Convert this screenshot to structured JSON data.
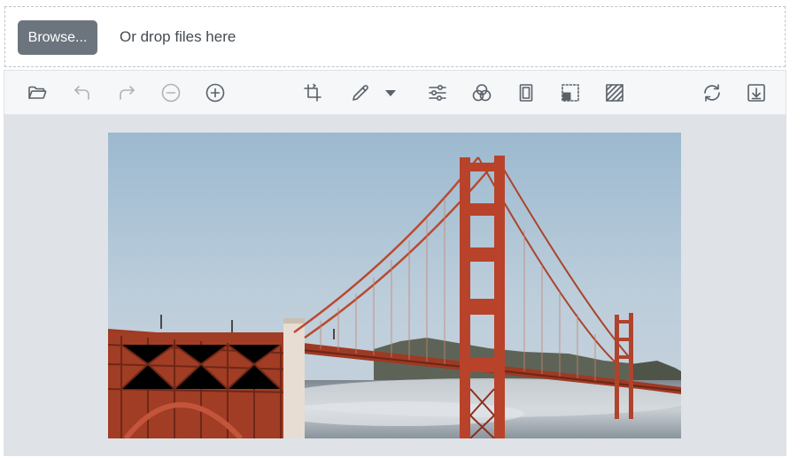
{
  "uploader": {
    "browse_label": "Browse...",
    "drop_hint": "Or drop files here"
  },
  "toolbar": {
    "tools": [
      {
        "name": "open",
        "icon": "folder-open-icon",
        "enabled": true
      },
      {
        "name": "undo",
        "icon": "undo-icon",
        "enabled": false
      },
      {
        "name": "redo",
        "icon": "redo-icon",
        "enabled": false
      },
      {
        "name": "zoom-out",
        "icon": "zoom-out-icon",
        "enabled": false
      },
      {
        "name": "zoom-in",
        "icon": "zoom-in-icon",
        "enabled": true
      },
      {
        "name": "crop",
        "icon": "crop-icon",
        "enabled": true
      },
      {
        "name": "draw",
        "icon": "pencil-icon",
        "enabled": true
      },
      {
        "name": "draw-menu",
        "icon": "caret-down-icon",
        "enabled": true
      },
      {
        "name": "adjust",
        "icon": "sliders-icon",
        "enabled": true
      },
      {
        "name": "filters",
        "icon": "color-circles-icon",
        "enabled": true
      },
      {
        "name": "frame",
        "icon": "frame-icon",
        "enabled": true
      },
      {
        "name": "resize",
        "icon": "resize-icon",
        "enabled": true
      },
      {
        "name": "watermark",
        "icon": "hatch-icon",
        "enabled": true
      },
      {
        "name": "reset",
        "icon": "refresh-icon",
        "enabled": true
      },
      {
        "name": "save",
        "icon": "download-icon",
        "enabled": true
      }
    ]
  },
  "colors": {
    "browse_button": "#6c757d",
    "canvas_background": "#dfe2e7",
    "toolbar_background": "#f5f7f9",
    "bridge_red": "#b7412a",
    "sky": "#a9c1d4"
  }
}
